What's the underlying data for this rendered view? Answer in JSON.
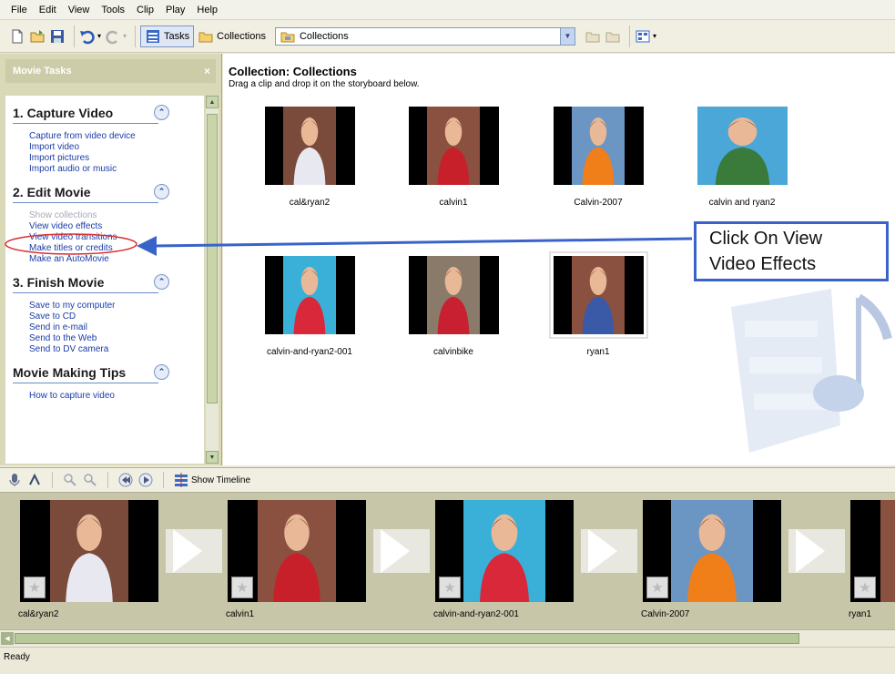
{
  "menu": [
    "File",
    "Edit",
    "View",
    "Tools",
    "Clip",
    "Play",
    "Help"
  ],
  "toolbar": {
    "tasks_label": "Tasks",
    "collections_label": "Collections",
    "collection_dropdown_value": "Collections"
  },
  "taskpane": {
    "header": "Movie Tasks",
    "sections": [
      {
        "title": "1. Capture Video",
        "links": [
          {
            "label": "Capture from video device",
            "disabled": false
          },
          {
            "label": "Import video",
            "disabled": false
          },
          {
            "label": "Import pictures",
            "disabled": false
          },
          {
            "label": "Import audio or music",
            "disabled": false
          }
        ]
      },
      {
        "title": "2. Edit Movie",
        "links": [
          {
            "label": "Show collections",
            "disabled": true
          },
          {
            "label": "View video effects",
            "disabled": false,
            "highlighted": true
          },
          {
            "label": "View video transitions",
            "disabled": false
          },
          {
            "label": "Make titles or credits",
            "disabled": false
          },
          {
            "label": "Make an AutoMovie",
            "disabled": false
          }
        ]
      },
      {
        "title": "3. Finish Movie",
        "links": [
          {
            "label": "Save to my computer",
            "disabled": false
          },
          {
            "label": "Save to CD",
            "disabled": false
          },
          {
            "label": "Send in e-mail",
            "disabled": false
          },
          {
            "label": "Send to the Web",
            "disabled": false
          },
          {
            "label": "Send to DV camera",
            "disabled": false
          }
        ]
      },
      {
        "title": "Movie Making Tips",
        "links": [
          {
            "label": "How to capture video",
            "disabled": false
          }
        ]
      }
    ]
  },
  "collection": {
    "title": "Collection: Collections",
    "subtitle": "Drag a clip and drop it on the storyboard below.",
    "clips": [
      {
        "name": "cal&ryan2",
        "colors": {
          "bg": "#7a4a3a",
          "subject": "#e8e8f0"
        }
      },
      {
        "name": "calvin1",
        "colors": {
          "bg": "#8a5040",
          "subject": "#c8202a"
        }
      },
      {
        "name": "Calvin-2007",
        "colors": {
          "bg": "#6b95c2",
          "subject": "#f07f1a"
        }
      },
      {
        "name": "calvin and ryan2",
        "colors": {
          "bg": "#4aa7d8",
          "subject": "#3a7a3a"
        }
      },
      {
        "name": "calvin-and-ryan2-001",
        "colors": {
          "bg": "#3ab0d8",
          "subject": "#d8283a"
        }
      },
      {
        "name": "calvinbike",
        "colors": {
          "bg": "#8a7a6a",
          "subject": "#c82030"
        }
      },
      {
        "name": "ryan1",
        "colors": {
          "bg": "#8a5040",
          "subject": "#3a5aa8"
        }
      }
    ]
  },
  "annotation": {
    "line1": "Click On View",
    "line2": "Video Effects"
  },
  "storyboard_toolbar": {
    "show_timeline_label": "Show Timeline"
  },
  "storyboard": {
    "items": [
      {
        "name": "cal&ryan2",
        "colors": {
          "bg": "#7a4a3a",
          "subject": "#e8e8f0"
        }
      },
      {
        "name": "calvin1",
        "colors": {
          "bg": "#8a5040",
          "subject": "#c8202a"
        }
      },
      {
        "name": "calvin-and-ryan2-001",
        "colors": {
          "bg": "#3ab0d8",
          "subject": "#d8283a"
        }
      },
      {
        "name": "Calvin-2007",
        "colors": {
          "bg": "#6b95c2",
          "subject": "#f07f1a"
        }
      },
      {
        "name": "ryan1",
        "colors": {
          "bg": "#8a5040",
          "subject": "#3a5aa8"
        }
      }
    ]
  },
  "status": {
    "text": "Ready"
  },
  "colors": {
    "link": "#1a3ca8",
    "annotation_border": "#3a63c9",
    "highlight_circle": "#d83030"
  }
}
